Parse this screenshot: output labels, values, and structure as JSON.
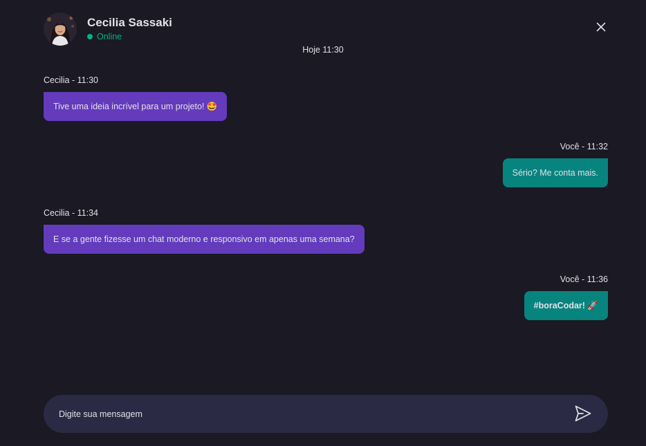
{
  "contact": {
    "name": "Cecilia Sassaki",
    "status": "Online",
    "status_color": "#00b37e"
  },
  "date_divider": "Hoje 11:30",
  "messages": [
    {
      "sender": "contact",
      "meta": "Cecilia - 11:30",
      "text": "Tive uma ideia incrível para um projeto! 🤩"
    },
    {
      "sender": "user",
      "meta": "Você - 11:32",
      "text": "Sério? Me conta mais."
    },
    {
      "sender": "contact",
      "meta": "Cecilia - 11:34",
      "text": "E se a gente fizesse um chat moderno e responsivo em apenas uma semana?"
    },
    {
      "sender": "user",
      "meta": "Você - 11:36",
      "text": "#boraCodar! 🚀"
    }
  ],
  "composer": {
    "placeholder": "Digite sua mensagem"
  },
  "colors": {
    "background": "#1a1924",
    "incoming_bubble": "#633bbc",
    "outgoing_bubble": "#07847e",
    "composer": "#2a2a44"
  },
  "icons": {
    "close": "close-icon",
    "send": "send-icon",
    "avatar": "avatar"
  }
}
